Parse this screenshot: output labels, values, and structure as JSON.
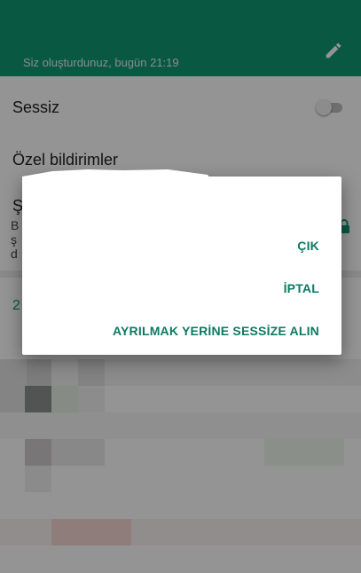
{
  "header": {
    "subtitle": "Siz oluşturdunuz, bugün 21:19",
    "edit_icon": "pencil-icon",
    "color": "#109a73"
  },
  "settings": {
    "mute_label": "Sessiz",
    "mute_enabled": false,
    "custom_notifications_label": "Özel bildirimler",
    "encryption_partial_title": "Ş",
    "encryption_partial_lines": [
      "B",
      "ş",
      "d"
    ],
    "participants_partial": "2"
  },
  "dialog": {
    "actions": {
      "exit": "ÇIK",
      "cancel": "İPTAL",
      "mute_instead": "AYRILMAK YERİNE SESSİZE ALIN"
    },
    "accent_color": "#0b7a63"
  }
}
